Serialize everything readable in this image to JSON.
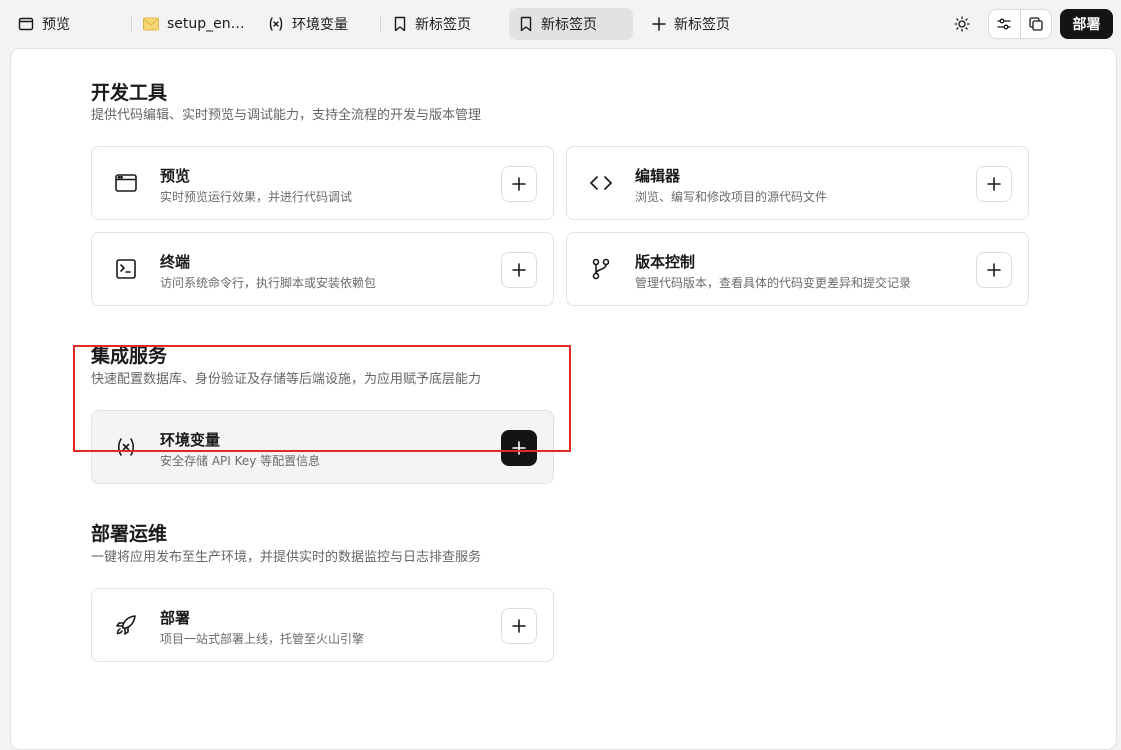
{
  "topbar": {
    "tabs": [
      {
        "label": "预览",
        "icon": "browser-window-icon"
      },
      {
        "label": "setup_env...",
        "icon": "envelope-icon"
      },
      {
        "label": "环境变量",
        "icon": "variable-icon"
      },
      {
        "label": "新标签页",
        "icon": "bookmark-icon"
      },
      {
        "label": "新标签页",
        "icon": "bookmark-icon",
        "active": true
      }
    ],
    "new_tab_label": "新标签页",
    "deploy_label": "部署"
  },
  "sections": [
    {
      "title": "开发工具",
      "desc": "提供代码编辑、实时预览与调试能力，支持全流程的开发与版本管理",
      "cards": [
        {
          "title": "预览",
          "desc": "实时预览运行效果，并进行代码调试",
          "icon": "browser-window-icon"
        },
        {
          "title": "编辑器",
          "desc": "浏览、编写和修改项目的源代码文件",
          "icon": "code-brackets-icon"
        },
        {
          "title": "终端",
          "desc": "访问系统命令行，执行脚本或安装依赖包",
          "icon": "terminal-icon"
        },
        {
          "title": "版本控制",
          "desc": "管理代码版本，查看具体的代码变更差异和提交记录",
          "icon": "git-branch-icon"
        }
      ]
    },
    {
      "title": "集成服务",
      "desc": "快速配置数据库、身份验证及存储等后端设施，为应用赋予底层能力",
      "cards": [
        {
          "title": "环境变量",
          "desc": "安全存储 API Key 等配置信息",
          "icon": "variable-icon"
        }
      ]
    },
    {
      "title": "部署运维",
      "desc": "一键将应用发布至生产环境，并提供实时的数据监控与日志排查服务",
      "cards": [
        {
          "title": "部署",
          "desc": "项目一站式部署上线，托管至火山引擎",
          "icon": "rocket-icon"
        }
      ]
    }
  ],
  "colors": {
    "highlight_border": "#e02b20",
    "primary_dark": "#141414"
  }
}
